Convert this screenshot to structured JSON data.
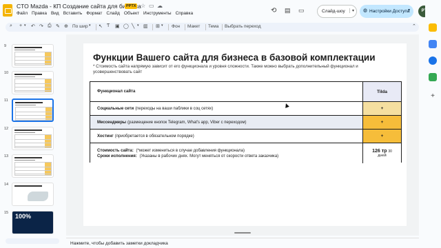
{
  "app": {
    "title": "CTO Mazda - КП Создание сайта для бизнеса",
    "badge": "PPTX",
    "menu": [
      "Файл",
      "Правка",
      "Вид",
      "Вставить",
      "Формат",
      "Слайд",
      "Объект",
      "Инструменты",
      "Справка"
    ],
    "slideshow_label": "Слайд-шоу",
    "share_label": "Настройки Доступа",
    "avatar_initials": "PT"
  },
  "toolbar": {
    "zoom": "По шир",
    "background": "Фон",
    "layout": "Макет",
    "theme": "Тема",
    "transition": "Выбрать переход"
  },
  "sidebar": {
    "slides": [
      {
        "num": "9"
      },
      {
        "num": "10"
      },
      {
        "num": "11"
      },
      {
        "num": "12"
      },
      {
        "num": "13"
      },
      {
        "num": "14"
      },
      {
        "num": "15",
        "text": "100%"
      }
    ]
  },
  "slide": {
    "title": "Функции Вашего сайта для бизнеса в базовой комплектации",
    "subtitle": "* Стоимость сайта напрямую зависит от его функционала и уровня сложности. Также можно выбрать дополнительный функционал и усовершенствовать сайт",
    "table": {
      "header": {
        "c1": "Функционал сайта",
        "c2": "Tilda"
      },
      "rows": [
        {
          "bold": "Социальные сети",
          "rest": "(переходы на ваши паблики в соц сетях)",
          "value": "+"
        },
        {
          "bold": "Мессенджеры",
          "rest": "(размещение кнопок Telegram, What's app, Viber с переходом)",
          "value": "+"
        },
        {
          "bold": "Хостинг",
          "rest": "(приобретается в обязательном порядке)",
          "value": "+"
        }
      ],
      "footer": {
        "cost_bold": "Стоимость сайта:",
        "cost_rest": "(*может измениться в случае добавления функционала)",
        "terms_bold": "Сроки исполнения:",
        "terms_rest": "(Указаны в рабочих днях. Могут меняться от скорости ответа заказчика)",
        "price": "126 тр",
        "days_num": "30",
        "days_label": "дней"
      }
    }
  },
  "notes": {
    "placeholder": "Нажмите, чтобы добавить заметки докладчика"
  }
}
